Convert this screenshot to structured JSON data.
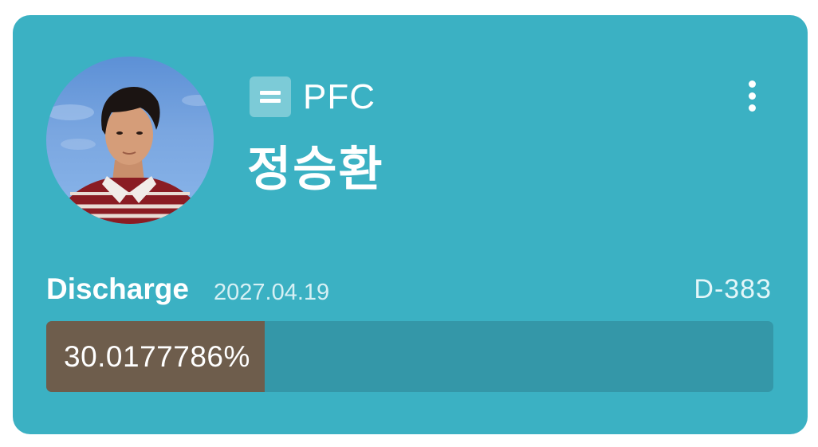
{
  "profile": {
    "rank_icon": "sergeant-rank-icon",
    "rank": "PFC",
    "name": "정승환",
    "avatar": "profile-photo"
  },
  "menu": {
    "icon": "more-vertical-icon"
  },
  "discharge": {
    "label": "Discharge",
    "date": "2027.04.19",
    "dday": "D-383"
  },
  "progress": {
    "percent": 30.0177786,
    "text": "30.0177786%"
  },
  "colors": {
    "card_background": "#3bb1c3",
    "track": "#3497a8",
    "fill": "#6e5d4c",
    "text": "#ffffff"
  }
}
